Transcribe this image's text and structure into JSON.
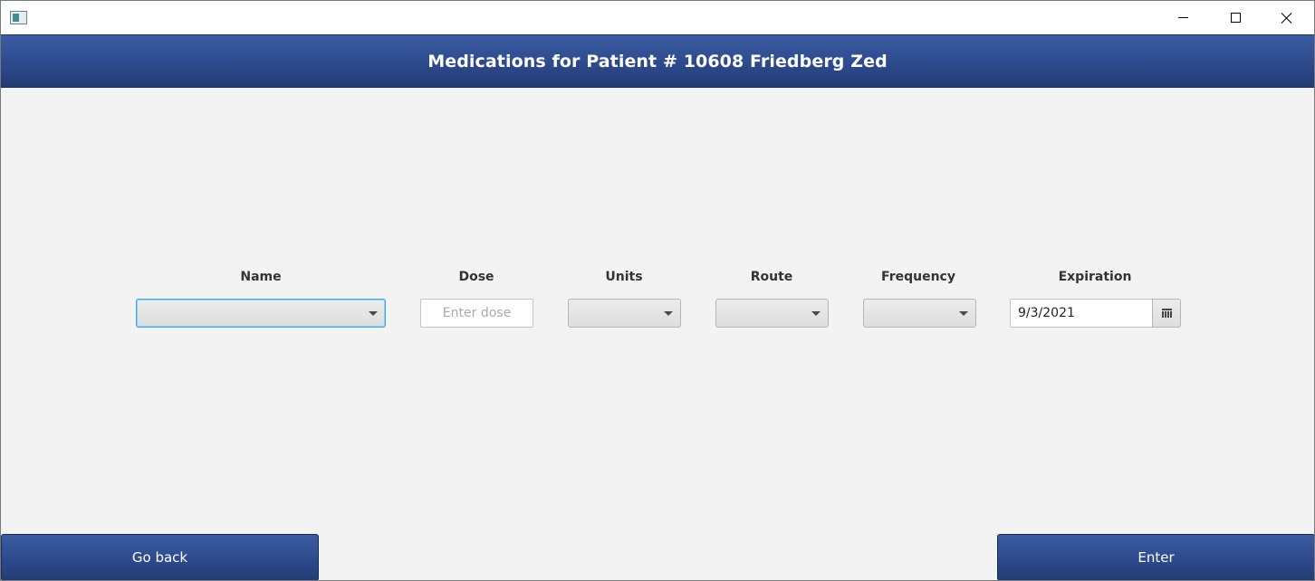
{
  "window": {
    "app_icon": "window-app-icon",
    "controls": [
      "minimize-icon",
      "maximize-icon",
      "close-icon"
    ]
  },
  "header": {
    "title": "Medications for Patient # 10608 Friedberg Zed"
  },
  "form": {
    "name": {
      "label": "Name",
      "value": ""
    },
    "dose": {
      "label": "Dose",
      "placeholder": "Enter dose",
      "value": ""
    },
    "units": {
      "label": "Units",
      "value": ""
    },
    "route": {
      "label": "Route",
      "value": ""
    },
    "frequency": {
      "label": "Frequency",
      "value": ""
    },
    "expiration": {
      "label": "Expiration",
      "value": "9/3/2021",
      "icon": "calendar-icon"
    }
  },
  "footer": {
    "back_label": "Go back",
    "enter_label": "Enter"
  },
  "colors": {
    "accent": "#2d4a8c",
    "focus": "#3ea4d9",
    "background": "#f3f3f3"
  }
}
